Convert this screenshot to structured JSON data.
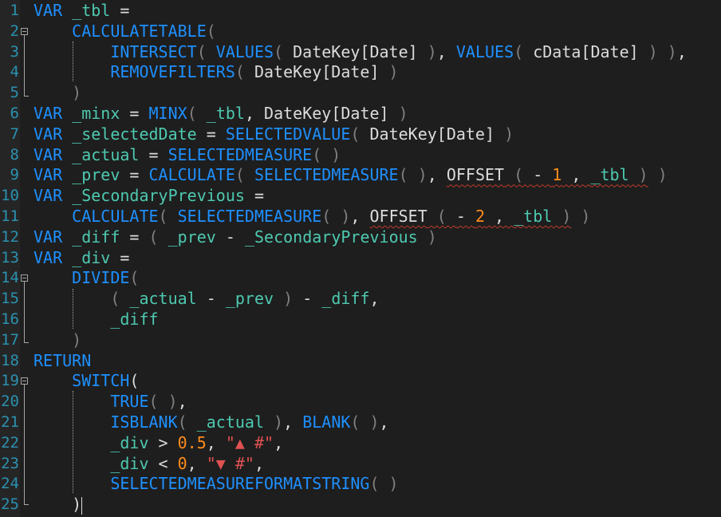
{
  "editor": {
    "language": "DAX",
    "line_numbers": [
      "1",
      "2",
      "3",
      "4",
      "5",
      "6",
      "7",
      "8",
      "9",
      "10",
      "11",
      "12",
      "13",
      "14",
      "15",
      "16",
      "17",
      "18",
      "19",
      "20",
      "21",
      "22",
      "23",
      "24",
      "25"
    ],
    "lines": [
      [
        [
          "kw",
          "VAR "
        ],
        [
          "var",
          "_tbl"
        ],
        [
          "t",
          " ="
        ]
      ],
      [
        [
          "t",
          "    "
        ],
        [
          "fn",
          "CALCULATETABLE"
        ],
        [
          "p",
          "("
        ]
      ],
      [
        [
          "t",
          "        "
        ],
        [
          "fn",
          "INTERSECT"
        ],
        [
          "p",
          "( "
        ],
        [
          "fn",
          "VALUES"
        ],
        [
          "p",
          "( "
        ],
        [
          "t",
          "DateKey[Date]"
        ],
        [
          "p",
          " )"
        ],
        [
          "t",
          ", "
        ],
        [
          "fn",
          "VALUES"
        ],
        [
          "p",
          "( "
        ],
        [
          "t",
          "cData[Date]"
        ],
        [
          "p",
          " ) )"
        ],
        [
          "t",
          ","
        ]
      ],
      [
        [
          "t",
          "        "
        ],
        [
          "fn",
          "REMOVEFILTERS"
        ],
        [
          "p",
          "( "
        ],
        [
          "t",
          "DateKey[Date]"
        ],
        [
          "p",
          " )"
        ]
      ],
      [
        [
          "t",
          "    "
        ],
        [
          "p",
          ")"
        ]
      ],
      [
        [
          "kw",
          "VAR "
        ],
        [
          "var",
          "_minx"
        ],
        [
          "t",
          " = "
        ],
        [
          "fn",
          "MINX"
        ],
        [
          "p",
          "( "
        ],
        [
          "var",
          "_tbl"
        ],
        [
          "t",
          ", DateKey[Date]"
        ],
        [
          "p",
          " )"
        ]
      ],
      [
        [
          "kw",
          "VAR "
        ],
        [
          "var",
          "_selectedDate"
        ],
        [
          "t",
          " = "
        ],
        [
          "fn",
          "SELECTEDVALUE"
        ],
        [
          "p",
          "( "
        ],
        [
          "t",
          "DateKey[Date]"
        ],
        [
          "p",
          " )"
        ]
      ],
      [
        [
          "kw",
          "VAR "
        ],
        [
          "var",
          "_actual"
        ],
        [
          "t",
          " = "
        ],
        [
          "fn",
          "SELECTEDMEASURE"
        ],
        [
          "p",
          "( )"
        ]
      ],
      [
        [
          "kw",
          "VAR "
        ],
        [
          "var",
          "_prev"
        ],
        [
          "t",
          " = "
        ],
        [
          "fn",
          "CALCULATE"
        ],
        [
          "p",
          "( "
        ],
        [
          "fn",
          "SELECTEDMEASURE"
        ],
        [
          "p",
          "( )"
        ],
        [
          "t",
          ", "
        ],
        [
          "sq",
          "OFFSET"
        ],
        [
          "sqp",
          " ( "
        ],
        [
          "sqt",
          "- "
        ],
        [
          "sqn",
          "1"
        ],
        [
          "sqt",
          " , "
        ],
        [
          "sqv",
          "_tbl"
        ],
        [
          "sqp",
          " )"
        ],
        [
          "p",
          " )"
        ]
      ],
      [
        [
          "kw",
          "VAR "
        ],
        [
          "var",
          "_SecondaryPrevious"
        ],
        [
          "t",
          " ="
        ]
      ],
      [
        [
          "t",
          "    "
        ],
        [
          "fn",
          "CALCULATE"
        ],
        [
          "p",
          "( "
        ],
        [
          "fn",
          "SELECTEDMEASURE"
        ],
        [
          "p",
          "( )"
        ],
        [
          "t",
          ", "
        ],
        [
          "sq",
          "OFFSET"
        ],
        [
          "sqp",
          " ( "
        ],
        [
          "sqt",
          "- "
        ],
        [
          "sqn",
          "2"
        ],
        [
          "sqt",
          " , "
        ],
        [
          "sqv",
          "_tbl"
        ],
        [
          "sqp",
          " )"
        ],
        [
          "p",
          " )"
        ]
      ],
      [
        [
          "kw",
          "VAR "
        ],
        [
          "var",
          "_diff"
        ],
        [
          "t",
          " = "
        ],
        [
          "p",
          "( "
        ],
        [
          "var",
          "_prev"
        ],
        [
          "t",
          " - "
        ],
        [
          "var",
          "_SecondaryPrevious"
        ],
        [
          "p",
          " )"
        ]
      ],
      [
        [
          "kw",
          "VAR "
        ],
        [
          "var",
          "_div"
        ],
        [
          "t",
          " ="
        ]
      ],
      [
        [
          "t",
          "    "
        ],
        [
          "fn",
          "DIVIDE"
        ],
        [
          "p",
          "("
        ]
      ],
      [
        [
          "t",
          "        "
        ],
        [
          "p",
          "( "
        ],
        [
          "var",
          "_actual"
        ],
        [
          "t",
          " - "
        ],
        [
          "var",
          "_prev"
        ],
        [
          "p",
          " )"
        ],
        [
          "t",
          " - "
        ],
        [
          "var",
          "_diff"
        ],
        [
          "t",
          ","
        ]
      ],
      [
        [
          "t",
          "        "
        ],
        [
          "var",
          "_diff"
        ]
      ],
      [
        [
          "t",
          "    "
        ],
        [
          "p",
          ")"
        ]
      ],
      [
        [
          "kw",
          "RETURN"
        ]
      ],
      [
        [
          "t",
          "    "
        ],
        [
          "fn",
          "SWITCH"
        ],
        [
          "t",
          "("
        ]
      ],
      [
        [
          "t",
          "        "
        ],
        [
          "fn",
          "TRUE"
        ],
        [
          "p",
          "( )"
        ],
        [
          "t",
          ","
        ]
      ],
      [
        [
          "t",
          "        "
        ],
        [
          "fn",
          "ISBLANK"
        ],
        [
          "p",
          "( "
        ],
        [
          "var",
          "_actual"
        ],
        [
          "p",
          " )"
        ],
        [
          "t",
          ", "
        ],
        [
          "fn",
          "BLANK"
        ],
        [
          "p",
          "( )"
        ],
        [
          "t",
          ","
        ]
      ],
      [
        [
          "t",
          "        "
        ],
        [
          "var",
          "_div"
        ],
        [
          "t",
          " > "
        ],
        [
          "num",
          "0.5"
        ],
        [
          "t",
          ", "
        ],
        [
          "str",
          "\"▲ #\""
        ],
        [
          "t",
          ","
        ]
      ],
      [
        [
          "t",
          "        "
        ],
        [
          "var",
          "_div"
        ],
        [
          "t",
          " < "
        ],
        [
          "num",
          "0"
        ],
        [
          "t",
          ", "
        ],
        [
          "str",
          "\"▼ #\""
        ],
        [
          "t",
          ","
        ]
      ],
      [
        [
          "t",
          "        "
        ],
        [
          "fn",
          "SELECTEDMEASUREFORMATSTRING"
        ],
        [
          "p",
          "( )"
        ]
      ],
      [
        [
          "t",
          "    "
        ],
        [
          "t",
          ")"
        ],
        [
          "caret",
          ""
        ]
      ]
    ]
  }
}
